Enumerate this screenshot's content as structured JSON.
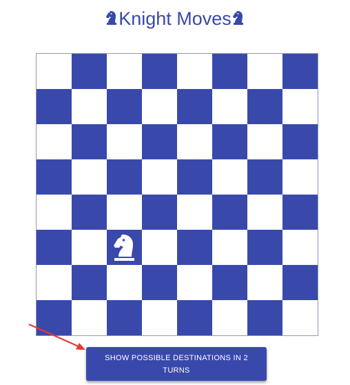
{
  "header": {
    "title": "Knight Moves",
    "left_icon": "knight-icon",
    "right_icon": "knight-icon"
  },
  "board": {
    "files": 8,
    "ranks": 8,
    "light_color": "#ffffff",
    "dark_color": "#3949ab",
    "knight_position": {
      "row": 5,
      "col": 2
    },
    "knight_icon": "white-knight-icon"
  },
  "action": {
    "label": "SHOW POSSIBLE DESTINATIONS IN 2 TURNS",
    "color": "#3949ab"
  },
  "annotation": {
    "arrow_color": "#e53935",
    "arrow_target": "action-button"
  }
}
